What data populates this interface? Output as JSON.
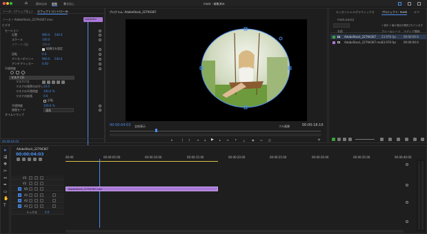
{
  "topbar": {
    "home": "home-icon",
    "tabs": [
      "読み込み",
      "編集",
      "書き出し"
    ],
    "active_tab": "編集",
    "title": "mask - 編集済み"
  },
  "left_panel": {
    "tabs": [
      "ソース：(クリップなし)",
      "エフェクトコントロール",
      "≡"
    ],
    "source_line": "ソース • AdobeStock_22794367.mov",
    "sequence_link": "AdobeStock_22794367.mov",
    "clip_label": "AdobeSto",
    "section_video": "ビデオ",
    "motion": "モーション",
    "position": {
      "label": "位置",
      "x": "960.0",
      "y": "540.0"
    },
    "scale": {
      "label": "スケール",
      "value": "100.0"
    },
    "scale_width": {
      "label": "スケール (幅)",
      "value": "100.0"
    },
    "uniform_scale": "縦横比を固定",
    "rotation": {
      "label": "回転",
      "value": "0.0"
    },
    "anchor": {
      "label": "アンカーポイント",
      "x": "960.0",
      "y": "540.0"
    },
    "antiflicker": {
      "label": "アンチフリッカー",
      "value": "0.00"
    },
    "opacity": "不透明度",
    "mask_name": "マスク (1)",
    "mask_path": "マスクパス",
    "mask_feather": {
      "label": "マスクの境界のぼかし",
      "value": "10.0"
    },
    "mask_opacity": {
      "label": "マスクの不透明度",
      "value": "100.0 %"
    },
    "mask_expansion": {
      "label": "マスクの拡張",
      "value": "0.0"
    },
    "inverted": "反転",
    "opacity_value": {
      "label": "不透明度",
      "value": "100.0 %"
    },
    "blend_mode": {
      "label": "描画モード",
      "value": "通常"
    },
    "time_remap": "タイムリマップ",
    "current_time": "00:00:04:03"
  },
  "program": {
    "tab": "プログラム: AdobeStock_22794367",
    "timecode": "00:00:04:03",
    "fit": "全体表示",
    "quality": "フル画質",
    "duration": "00:00:18:10"
  },
  "project": {
    "tabs": [
      "エッセンシャルグラフィックス",
      "プロジェクト: mask",
      "エフ"
    ],
    "file": "mask.prproj",
    "status": "1 個中 1 個の項目が選択されています",
    "columns": [
      "名前",
      "フレームレート",
      "メディア開始"
    ],
    "rows": [
      {
        "name": "AdobeStock_22794367",
        "fps": "23.976 fps",
        "start": "00:00:00:0",
        "color": "#3aa13a"
      },
      {
        "name": "AdobeStock_22794367.mov",
        "fps": "23.976 fps",
        "start": "00:00:00:0",
        "color": "#a978d8"
      }
    ]
  },
  "timeline": {
    "tab": "AdobeStock_22794367",
    "timecode": "00:00:04:03",
    "ruler": [
      "00:00",
      "00:00:05:00",
      "00:00:10:00",
      "00:00:15:00",
      "00:00:20:00",
      "00:00:25:00",
      "00:00:30:00",
      "00:00:35:00",
      "00:00:40:00"
    ],
    "tracks_video": [
      "V3",
      "V2",
      "V1"
    ],
    "tracks_audio": [
      "A1",
      "A2",
      "A3"
    ],
    "clip_label": "AdobeStock_22794367.mov",
    "master": {
      "label": "ミックス",
      "value": "0.0"
    }
  },
  "colors": {
    "accent": "#4d8ff0",
    "clip": "#a978d8",
    "selected": "#3aa13a"
  }
}
